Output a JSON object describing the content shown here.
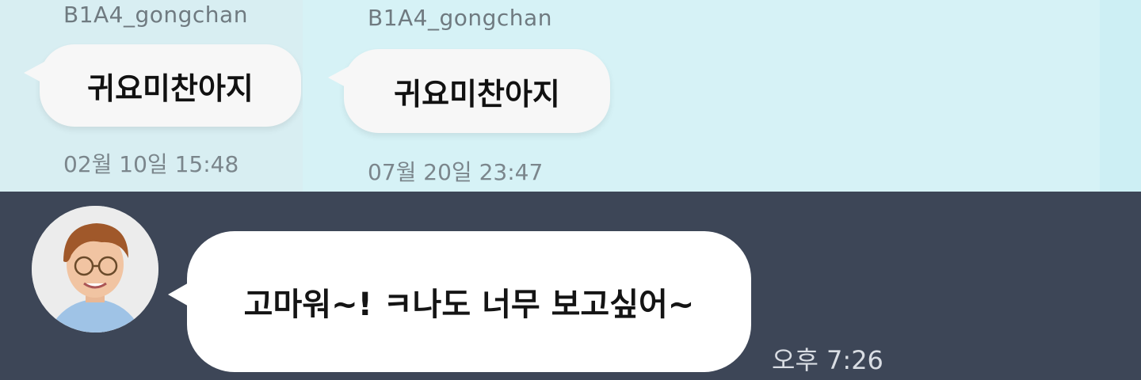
{
  "screens": [
    {
      "username": "B1A4_gongchan",
      "message": "귀요미찬아지",
      "timestamp": "02월 10일 15:48"
    },
    {
      "username": "B1A4_gongchan",
      "message": "귀요미찬아지",
      "timestamp": "07월 20일 23:47"
    }
  ],
  "chat": {
    "message": "고마워~! ㅋ나도 너무 보고싶어~",
    "time": "오후 7:26",
    "avatar_icon": "person-avatar"
  },
  "colors": {
    "top_bg": "#d6f2f6",
    "chat_bg": "#3d4657",
    "bubble": "#ffffff"
  }
}
